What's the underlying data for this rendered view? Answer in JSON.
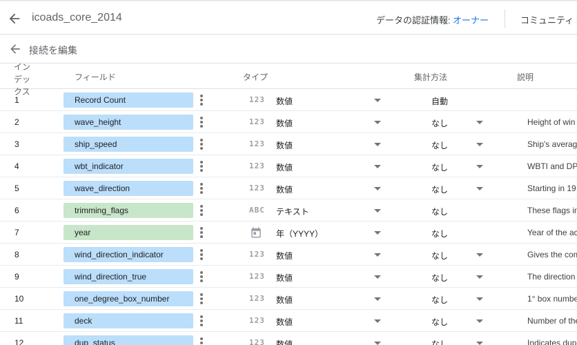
{
  "header": {
    "title": "icoads_core_2014",
    "credentials_label": "データの認証情報:",
    "credentials_value": "オーナー",
    "community_label": "コミュニティ During"
  },
  "subheader": {
    "edit_connection_label": "接続を編集"
  },
  "columns": {
    "index": "インデックス",
    "field": "フィールド",
    "type": "タイプ",
    "aggregation": "集計方法",
    "description": "説明"
  },
  "rows": [
    {
      "index": "1",
      "field": "Record Count",
      "chip": "blue",
      "type_icon": "123",
      "type": "数値",
      "agg": "自動",
      "agg_dropdown": false,
      "desc": ""
    },
    {
      "index": "2",
      "field": "wave_height",
      "chip": "blue",
      "type_icon": "123",
      "type": "数値",
      "agg": "なし",
      "agg_dropdown": true,
      "desc": "Height of win"
    },
    {
      "index": "3",
      "field": "ship_speed",
      "chip": "blue",
      "type_icon": "123",
      "type": "数値",
      "agg": "なし",
      "agg_dropdown": true,
      "desc": "Ship's average"
    },
    {
      "index": "4",
      "field": "wbt_indicator",
      "chip": "blue",
      "type_icon": "123",
      "type": "数値",
      "agg": "なし",
      "agg_dropdown": true,
      "desc": "WBTI and DPT"
    },
    {
      "index": "5",
      "field": "wave_direction",
      "chip": "blue",
      "type_icon": "123",
      "type": "数値",
      "agg": "なし",
      "agg_dropdown": true,
      "desc": "Starting in 19"
    },
    {
      "index": "6",
      "field": "trimming_flags",
      "chip": "green",
      "type_icon": "ABC",
      "type": "テキスト",
      "agg": "なし",
      "agg_dropdown": false,
      "desc": "These flags in"
    },
    {
      "index": "7",
      "field": "year",
      "chip": "green",
      "type_icon": "calendar",
      "type": "年（YYYY）",
      "agg": "なし",
      "agg_dropdown": false,
      "desc": "Year of the ac"
    },
    {
      "index": "8",
      "field": "wind_direction_indicator",
      "chip": "blue",
      "type_icon": "123",
      "type": "数値",
      "agg": "なし",
      "agg_dropdown": true,
      "desc": "Gives the com"
    },
    {
      "index": "9",
      "field": "wind_direction_true",
      "chip": "blue",
      "type_icon": "123",
      "type": "数値",
      "agg": "なし",
      "agg_dropdown": true,
      "desc": "The direction"
    },
    {
      "index": "10",
      "field": "one_degree_box_number",
      "chip": "blue",
      "type_icon": "123",
      "type": "数値",
      "agg": "なし",
      "agg_dropdown": true,
      "desc": "1° box numbe"
    },
    {
      "index": "11",
      "field": "deck",
      "chip": "blue",
      "type_icon": "123",
      "type": "数値",
      "agg": "なし",
      "agg_dropdown": true,
      "desc": "Number of the"
    },
    {
      "index": "12",
      "field": "dup_status",
      "chip": "blue",
      "type_icon": "123",
      "type": "数値",
      "agg": "なし",
      "agg_dropdown": true,
      "desc": "Indicates dup"
    }
  ],
  "colors": {
    "chip_number": "#bbdefb",
    "chip_text": "#c8e6c9",
    "link": "#1a73e8"
  }
}
